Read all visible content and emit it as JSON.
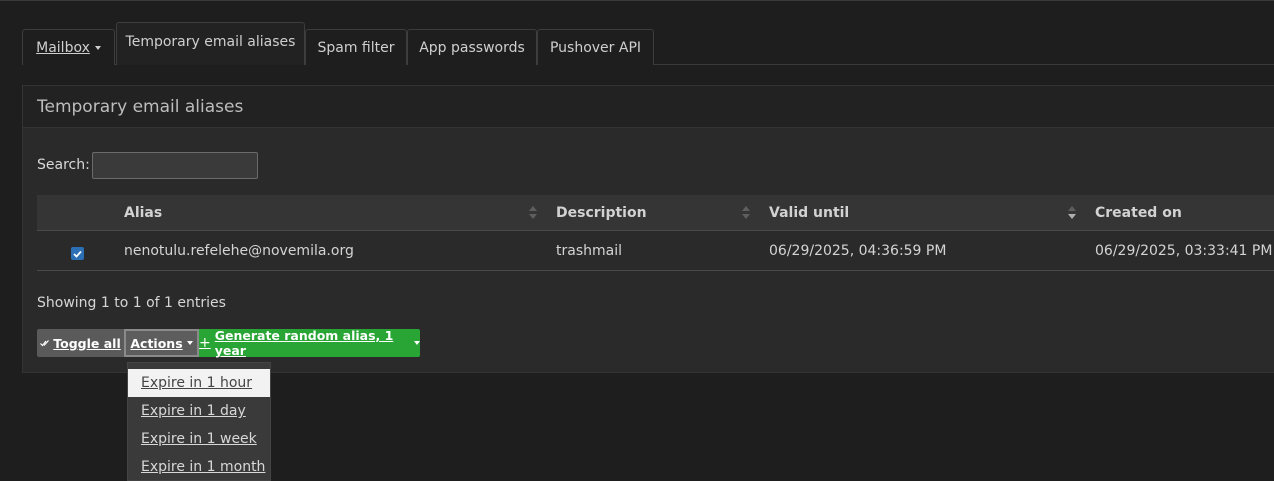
{
  "tabs": [
    {
      "label": "Mailbox",
      "dropdown": true
    },
    {
      "label": "Temporary email aliases",
      "active": true
    },
    {
      "label": "Spam filter"
    },
    {
      "label": "App passwords"
    },
    {
      "label": "Pushover API"
    }
  ],
  "panel": {
    "title": "Temporary email aliases"
  },
  "search": {
    "label": "Search:",
    "value": ""
  },
  "table": {
    "columns": [
      "Alias",
      "Description",
      "Valid until",
      "Created on"
    ],
    "rows": [
      {
        "checked": true,
        "alias": "nenotulu.refelehe@novemila.org",
        "description": "trashmail",
        "valid_until": "06/29/2025, 04:36:59 PM",
        "created_on": "06/29/2025, 03:33:41 PM"
      }
    ],
    "info": "Showing 1 to 1 of 1 entries"
  },
  "buttons": {
    "toggle_all": "Toggle all",
    "actions": "Actions",
    "generate": "Generate random alias, 1 year"
  },
  "actions_menu": [
    "Expire in 1 hour",
    "Expire in 1 day",
    "Expire in 1 week",
    "Expire in 1 month"
  ],
  "colors": {
    "background": "#1e1e1f",
    "generate_button": "#28a534",
    "checkbox": "#2b6fb5"
  }
}
